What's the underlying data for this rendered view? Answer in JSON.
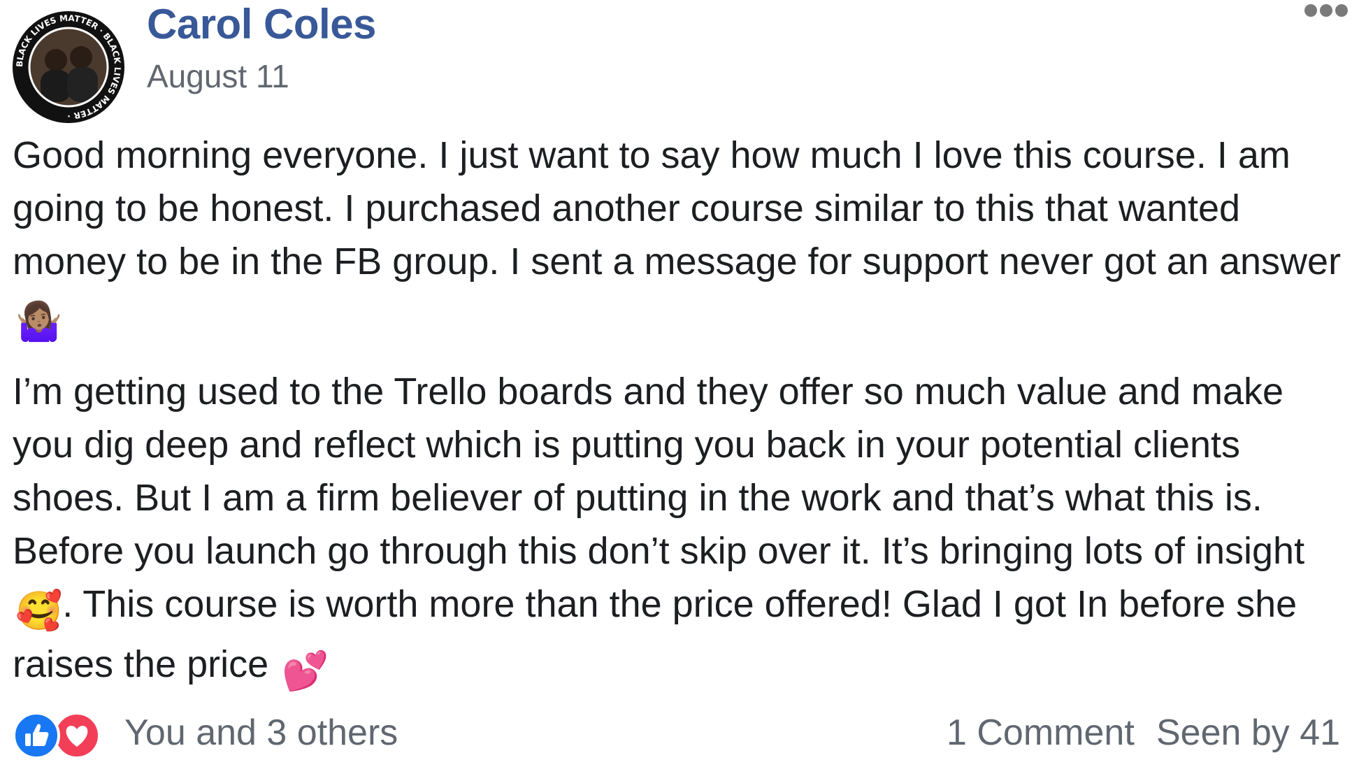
{
  "post": {
    "author": "Carol Coles",
    "date": "August 11",
    "avatar_ring_text": "BLACK LIVES MATTER · BLACK LIVES MATTER ·",
    "paragraphs": [
      {
        "text": "Good morning everyone. I just want to say how much I love this course. I am going to be honest. I purchased another course similar to this that wanted money to be in the FB group. I sent a message for support never got an answer",
        "emoji": "🤷🏽‍♀️"
      }
    ],
    "paragraph2": {
      "part1": "I’m getting used to the Trello boards and they offer so much value and make you dig deep and reflect which is putting you back in your potential clients shoes. But I am a firm believer of putting in the work and that’s what this is. Before you launch go through this don’t skip over it. It’s bringing lots of insight",
      "emoji1": "🥰",
      "part2": ". This course is worth more than the price offered! Glad I got In before she raises the price",
      "emoji2": "💕"
    }
  },
  "footer": {
    "reactions": [
      "like-icon",
      "love-icon"
    ],
    "reactors": "You and 3 others",
    "comments": "1 Comment",
    "seen_by": "Seen by 41"
  },
  "colors": {
    "author_link": "#385898",
    "meta_text": "#616770",
    "like_blue": "#1877f2",
    "love_red": "#f33e58"
  }
}
